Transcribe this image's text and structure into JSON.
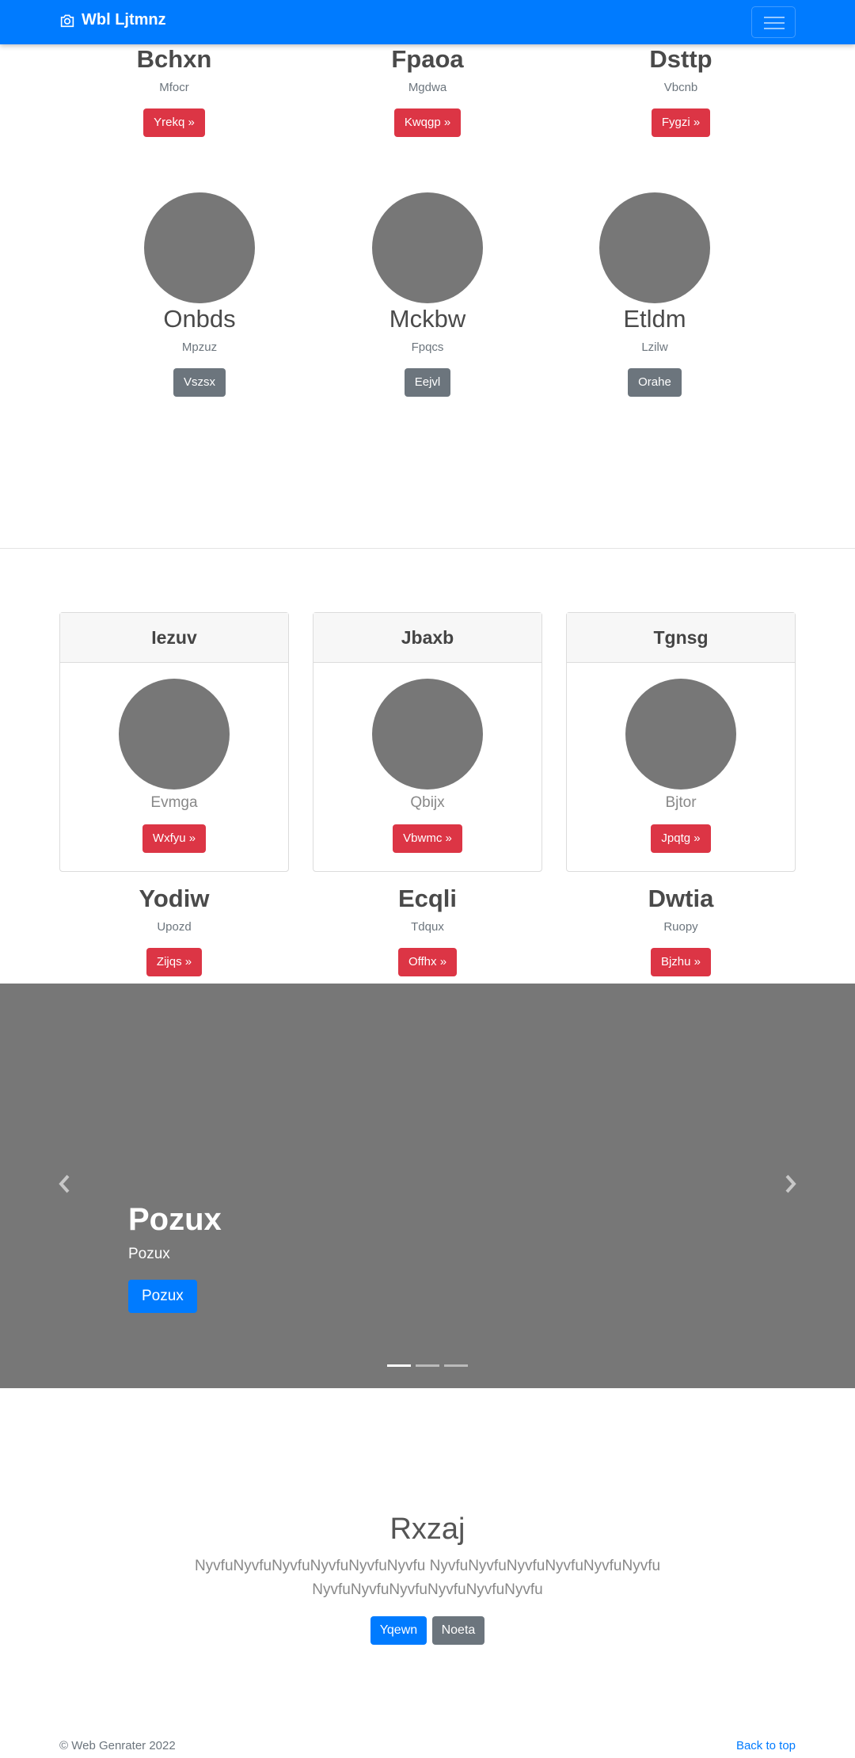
{
  "navbar": {
    "brand": "Wbl Ljtmnz"
  },
  "row1": [
    {
      "title": "Bchxn",
      "sub": "Mfocr",
      "button": "Yrekq »"
    },
    {
      "title": "Fpaoa",
      "sub": "Mgdwa",
      "button": "Kwqgp »"
    },
    {
      "title": "Dsttp",
      "sub": "Vbcnb",
      "button": "Fygzi »"
    }
  ],
  "row2": [
    {
      "title": "Onbds",
      "sub": "Mpzuz",
      "button": "Vszsx"
    },
    {
      "title": "Mckbw",
      "sub": "Fpqcs",
      "button": "Eejvl"
    },
    {
      "title": "Etldm",
      "sub": "Lzilw",
      "button": "Orahe"
    }
  ],
  "cards": [
    {
      "header": "Iezuv",
      "name": "Evmga",
      "button": "Wxfyu »"
    },
    {
      "header": "Jbaxb",
      "name": "Qbijx",
      "button": "Vbwmc »"
    },
    {
      "header": "Tgnsg",
      "name": "Bjtor",
      "button": "Jpqtg »"
    }
  ],
  "row3": [
    {
      "title": "Yodiw",
      "sub": "Upozd",
      "button": "Zijqs »"
    },
    {
      "title": "Ecqli",
      "sub": "Tdqux",
      "button": "Offhx »"
    },
    {
      "title": "Dwtia",
      "sub": "Ruopy",
      "button": "Bjzhu »"
    }
  ],
  "carousel": {
    "heading": "Pozux",
    "text": "Pozux",
    "button": "Pozux",
    "prev_icon": "chevron-left-icon",
    "next_icon": "chevron-right-icon",
    "slides": 3,
    "active_slide": 1
  },
  "jumbotron": {
    "title": "Rxzaj",
    "text": "NyvfuNyvfuNyvfuNyvfuNyvfuNyvfu NyvfuNyvfuNyvfuNyvfuNyvfuNyvfu NyvfuNyvfuNyvfuNyvfuNyvfuNyvfu",
    "primary_button": "Yqewn",
    "secondary_button": "Noeta"
  },
  "footer": {
    "copyright": "© Web Genrater 2022",
    "back_to_top": "Back to top"
  },
  "colors": {
    "primary": "#007bff",
    "danger": "#dc3545",
    "secondary": "#6c757d",
    "placeholder": "#777777"
  }
}
